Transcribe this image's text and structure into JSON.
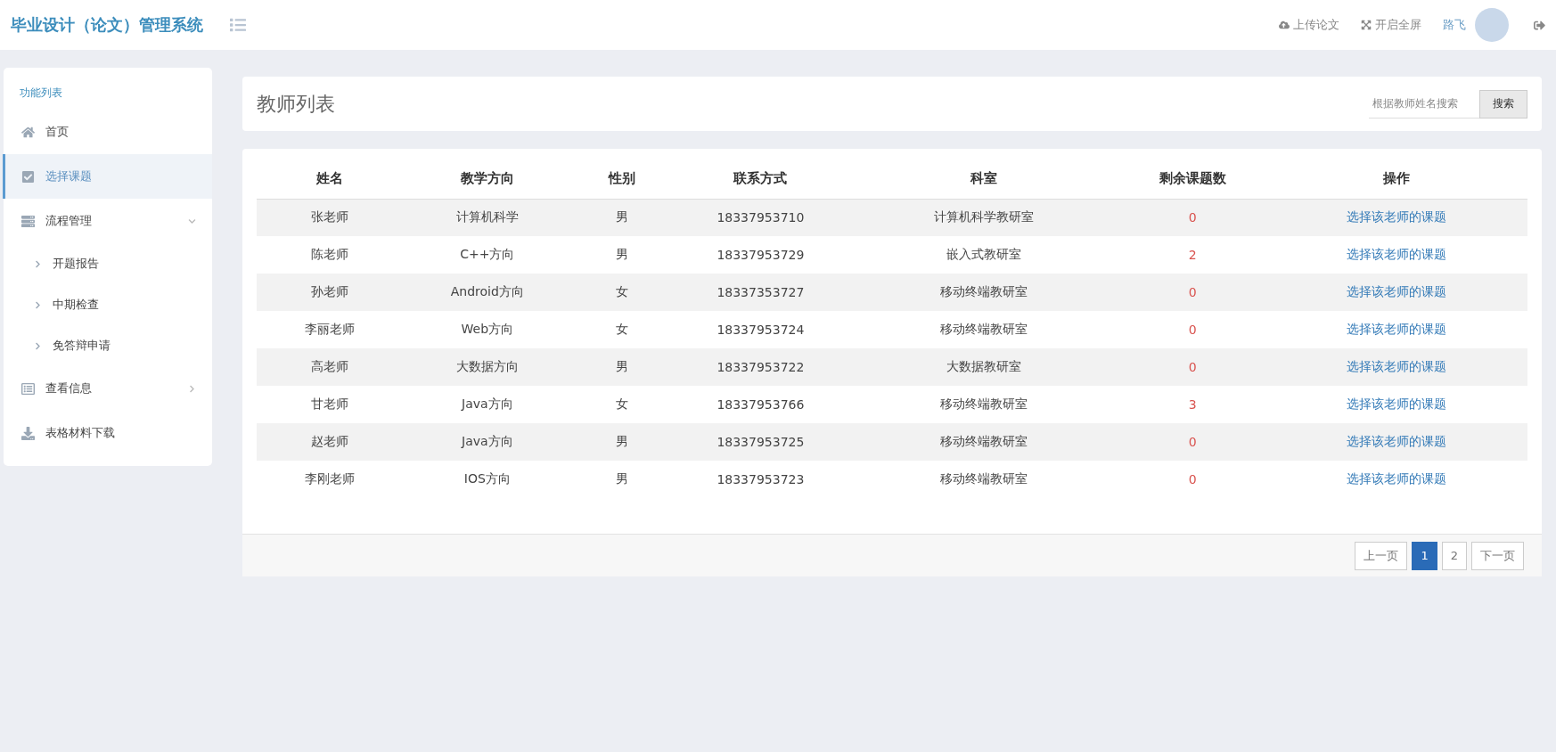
{
  "header": {
    "title": "毕业设计（论文）管理系统",
    "actions": [
      {
        "label": "上传论文"
      },
      {
        "label": "开启全屏"
      }
    ],
    "user_name": "路飞"
  },
  "sidebar": {
    "heading": "功能列表",
    "items": [
      {
        "label": "首页",
        "selected": false
      },
      {
        "label": "选择课题",
        "selected": true
      },
      {
        "label": "流程管理",
        "selected": false,
        "expanded": true,
        "children": [
          {
            "label": "开题报告",
            "selected": false
          },
          {
            "label": "中期检查",
            "selected": false
          },
          {
            "label": "免答辩申请",
            "selected": false
          }
        ]
      },
      {
        "label": "查看信息",
        "selected": false,
        "expanded": false
      },
      {
        "label": "表格材料下载",
        "selected": false
      }
    ]
  },
  "panel": {
    "title": "教师列表",
    "search": {
      "placeholder": "根据教师姓名搜索",
      "button": "搜索"
    }
  },
  "table": {
    "columns": [
      "姓名",
      "教学方向",
      "性别",
      "联系方式",
      "科室",
      "剩余课题数",
      "操作"
    ],
    "rows": [
      {
        "name": "张老师",
        "direction": "计算机科学",
        "gender": "男",
        "phone": "18337953710",
        "office": "计算机科学教研室",
        "remaining": "0",
        "action": "选择该老师的课题"
      },
      {
        "name": "陈老师",
        "direction": "C++方向",
        "gender": "男",
        "phone": "18337953729",
        "office": "嵌入式教研室",
        "remaining": "2",
        "action": "选择该老师的课题"
      },
      {
        "name": "孙老师",
        "direction": "Android方向",
        "gender": "女",
        "phone": "18337353727",
        "office": "移动终端教研室",
        "remaining": "0",
        "action": "选择该老师的课题"
      },
      {
        "name": "李丽老师",
        "direction": "Web方向",
        "gender": "女",
        "phone": "18337953724",
        "office": "移动终端教研室",
        "remaining": "0",
        "action": "选择该老师的课题"
      },
      {
        "name": "高老师",
        "direction": "大数据方向",
        "gender": "男",
        "phone": "18337953722",
        "office": "大数据教研室",
        "remaining": "0",
        "action": "选择该老师的课题"
      },
      {
        "name": "甘老师",
        "direction": "Java方向",
        "gender": "女",
        "phone": "18337953766",
        "office": "移动终端教研室",
        "remaining": "3",
        "action": "选择该老师的课题"
      },
      {
        "name": "赵老师",
        "direction": "Java方向",
        "gender": "男",
        "phone": "18337953725",
        "office": "移动终端教研室",
        "remaining": "0",
        "action": "选择该老师的课题"
      },
      {
        "name": "李刚老师",
        "direction": "IOS方向",
        "gender": "男",
        "phone": "18337953723",
        "office": "移动终端教研室",
        "remaining": "0",
        "action": "选择该老师的课题"
      }
    ]
  },
  "pagination": {
    "prev": "上一页",
    "pages": [
      {
        "label": "1",
        "selected": true
      },
      {
        "label": "2",
        "selected": false
      }
    ],
    "next": "下一页"
  }
}
